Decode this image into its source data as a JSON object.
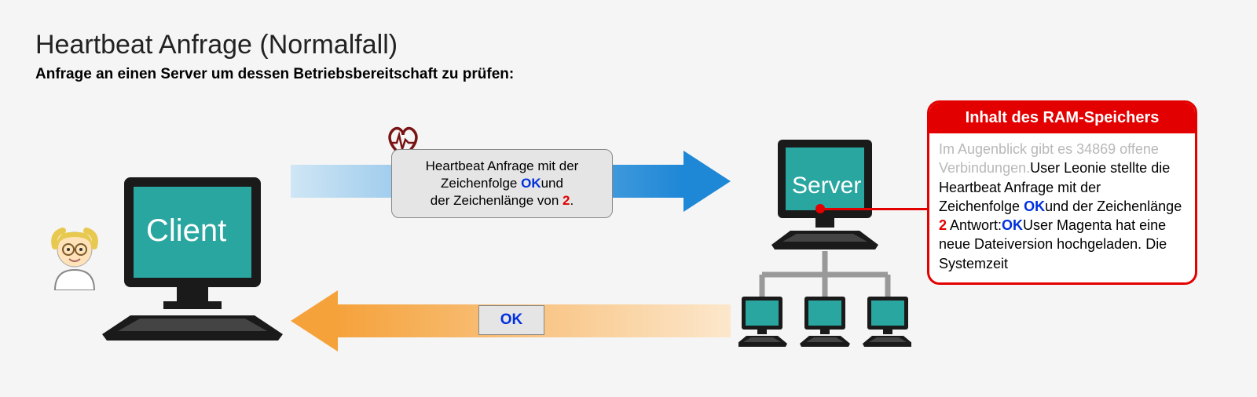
{
  "title": "Heartbeat Anfrage (Normalfall)",
  "subtitle": "Anfrage an einen Server um dessen Betriebsbereitschaft zu prüfen:",
  "client_label": "Client",
  "server_label": "Server",
  "request": {
    "line1": "Heartbeat Anfrage mit der",
    "line2a": "Zeichenfolge ",
    "ok": "OK",
    "line2b": "und",
    "line3a": "der Zeichenlänge von ",
    "len": "2",
    "line3b": "."
  },
  "response_ok": "OK",
  "ram": {
    "header": "Inhalt des RAM-Speichers",
    "faded": "Im Augenblick gibt es 34869 offene Verbindungen.",
    "part1": "User Leonie stellte die Heartbeat Anfrage mit der Zeichenfolge ",
    "ok1": "OK",
    "part2": "und der Zeichenlänge ",
    "len": "2",
    "part3": " Antwort:",
    "ok2": "OK",
    "part4": "User Magenta hat eine neue Dateiversion hochgeladen. Die Systemzeit"
  },
  "colors": {
    "teal": "#2aa6a0",
    "blue": "#1e87d6",
    "orange": "#f5a23b",
    "red": "#e30000"
  }
}
